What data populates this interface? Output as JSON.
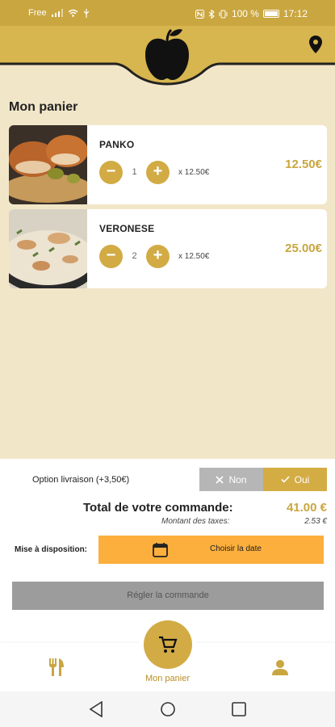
{
  "status_bar": {
    "carrier": "Free",
    "battery": "100 %",
    "time": "17:12"
  },
  "colors": {
    "accent": "#c9a640",
    "background": "#f2e6c9",
    "date_button": "#fcaf3d",
    "disabled": "#9c9c9c"
  },
  "header": {
    "logo_icon": "apple-icon",
    "location_icon": "map-pin-icon"
  },
  "page_title": "Mon panier",
  "cart_items": [
    {
      "name": "PANKO",
      "quantity": "1",
      "unit_price": "x 12.50€",
      "price": "12.50€"
    },
    {
      "name": "VERONESE",
      "quantity": "2",
      "unit_price": "x 12.50€",
      "price": "25.00€"
    }
  ],
  "delivery": {
    "label": "Option livraison (+3,50€)",
    "no_label": "Non",
    "yes_label": "Oui",
    "selected": "Oui"
  },
  "summary": {
    "total_label": "Total de votre commande:",
    "total_value": "41.00 €",
    "tax_label": "Montant des taxes:",
    "tax_value": "2.53 €"
  },
  "availability": {
    "label": "Mise à disposition:",
    "button_label": "Choisir la date"
  },
  "pay_button": "Régler la commande",
  "bottom_nav": {
    "cart_label": "Mon panier"
  }
}
